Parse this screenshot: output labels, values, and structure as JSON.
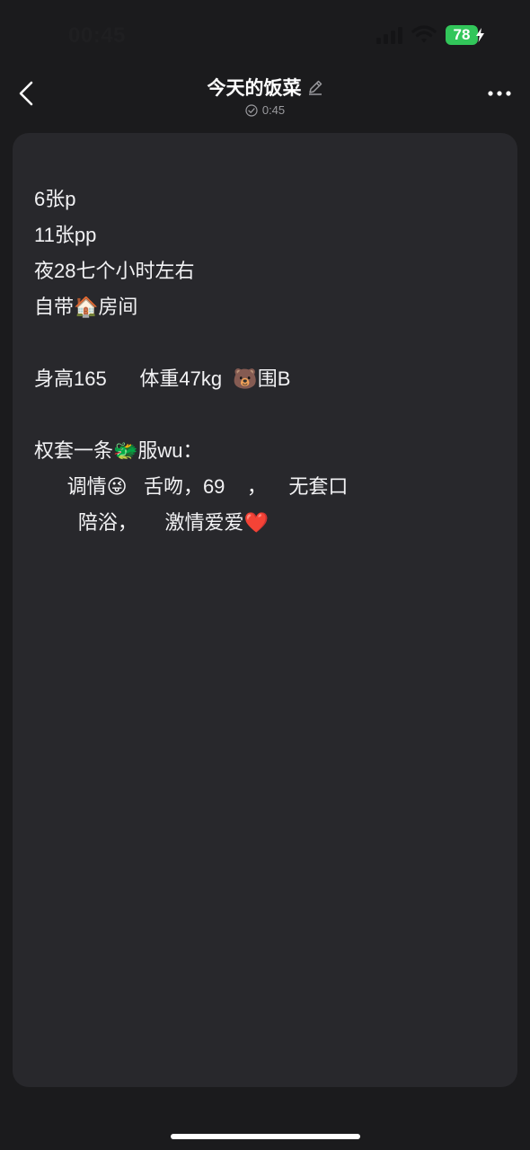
{
  "status_bar": {
    "time": "00:45",
    "battery_level": "78",
    "icons": [
      "signal-icon",
      "wifi-icon",
      "battery-icon",
      "charging-bolt-icon"
    ]
  },
  "nav": {
    "title": "今天的饭菜",
    "saved_time": "0:45",
    "icons": [
      "back-chevron-icon",
      "edit-pencil-icon",
      "saved-check-icon",
      "more-dots-icon"
    ]
  },
  "note": {
    "lines": [
      "6张p",
      "11张pp",
      "夜28七个小时左右",
      "自带🏠房间",
      "",
      "身高165      体重47kg  🐻围B",
      "",
      "权套一条🐲服wu：",
      "      调情😜   舌吻，69    ，    无套口",
      "        陪浴，     激情爱爱❤️"
    ]
  },
  "colors": {
    "background": "#1b1b1d",
    "card": "#28282c",
    "text": "#f2f2f4",
    "secondary_text": "#9a9a9e",
    "battery": "#32c65a"
  }
}
